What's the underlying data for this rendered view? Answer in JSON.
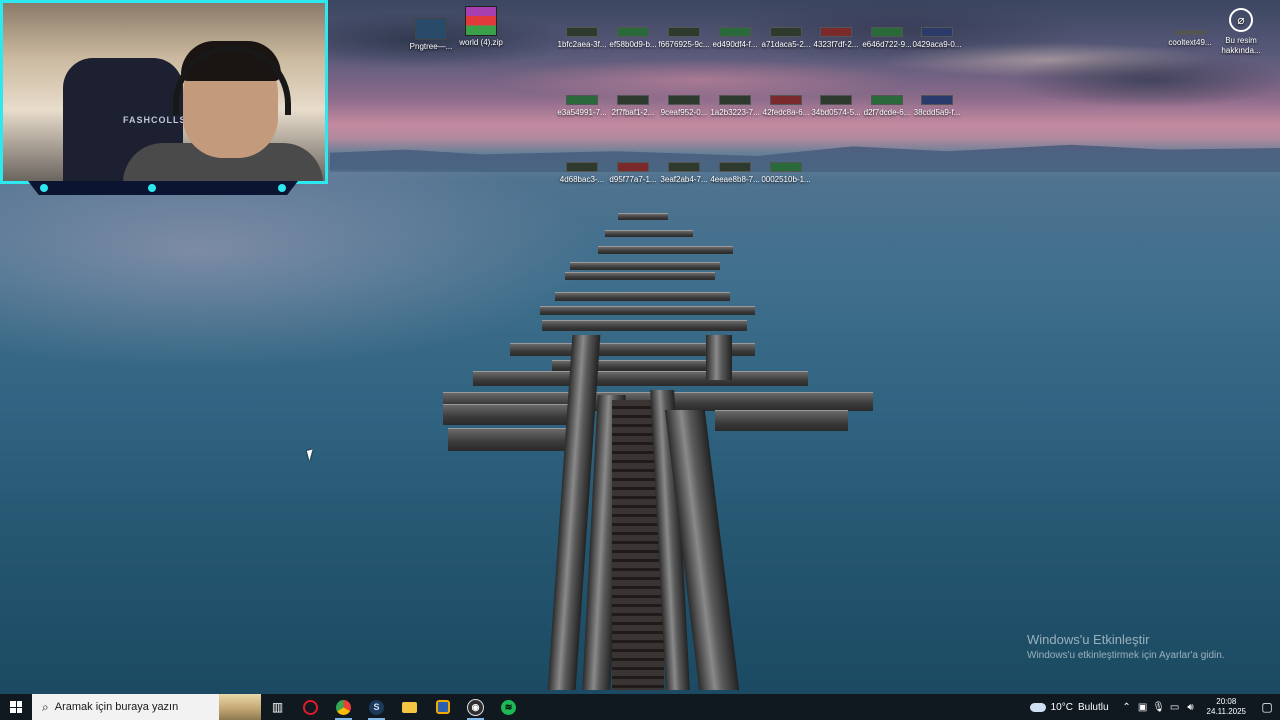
{
  "webcam": {
    "chair_brand": "FASHCOLLS"
  },
  "desktop_icons_row0": [
    {
      "label": "Pngtree—..."
    },
    {
      "label": "world (4).zip"
    }
  ],
  "desktop_icons_row1": [
    {
      "label": "1bfc2aea-3f..."
    },
    {
      "label": "ef58b0d9-b..."
    },
    {
      "label": "f6676925-9c..."
    },
    {
      "label": "ed490df4-f..."
    },
    {
      "label": "a71daca5-2..."
    },
    {
      "label": "4323f7df-2..."
    },
    {
      "label": "e646d722-9..."
    },
    {
      "label": "0429aca9-0..."
    }
  ],
  "desktop_icons_row2": [
    {
      "label": "e3a54991-7..."
    },
    {
      "label": "2f7fbaf1-2..."
    },
    {
      "label": "9ceaf952-0..."
    },
    {
      "label": "1a2b3223-7..."
    },
    {
      "label": "42fedc8a-6..."
    },
    {
      "label": "34bd0574-5..."
    },
    {
      "label": "d2f7dcde-6..."
    },
    {
      "label": "38cdd5a9-f..."
    }
  ],
  "desktop_icons_row3": [
    {
      "label": "4d68bac3-..."
    },
    {
      "label": "d95f77a7-1..."
    },
    {
      "label": "3eaf2ab4-7..."
    },
    {
      "label": "4eeae8b8-7..."
    },
    {
      "label": "0002510b-1..."
    }
  ],
  "cooltext": {
    "label": "cooltext49..."
  },
  "user_info": {
    "label": "Bu resim hakkında..."
  },
  "watermark": {
    "title": "Windows'u Etkinleştir",
    "subtitle": "Windows'u etkinleştirmek için Ayarlar'a gidin."
  },
  "taskbar": {
    "search_placeholder": "Aramak için buraya yazın",
    "apps": [
      {
        "icon": "task-view-icon"
      },
      {
        "icon": "opera-icon",
        "color": "#e01b2b"
      },
      {
        "icon": "chrome-icon",
        "color": "#4285f4"
      },
      {
        "icon": "steam-icon",
        "color": "#1b2838"
      },
      {
        "icon": "file-explorer-icon",
        "color": "#f4c542"
      },
      {
        "icon": "shield-app-icon",
        "color": "#f2a900"
      },
      {
        "icon": "obs-icon",
        "color": "#302e31"
      },
      {
        "icon": "spotify-icon",
        "color": "#1db954"
      }
    ],
    "weather": {
      "temp": "10°C",
      "condition": "Bulutlu"
    },
    "clock": {
      "time": "20:08",
      "date": "24.11.2025"
    }
  }
}
